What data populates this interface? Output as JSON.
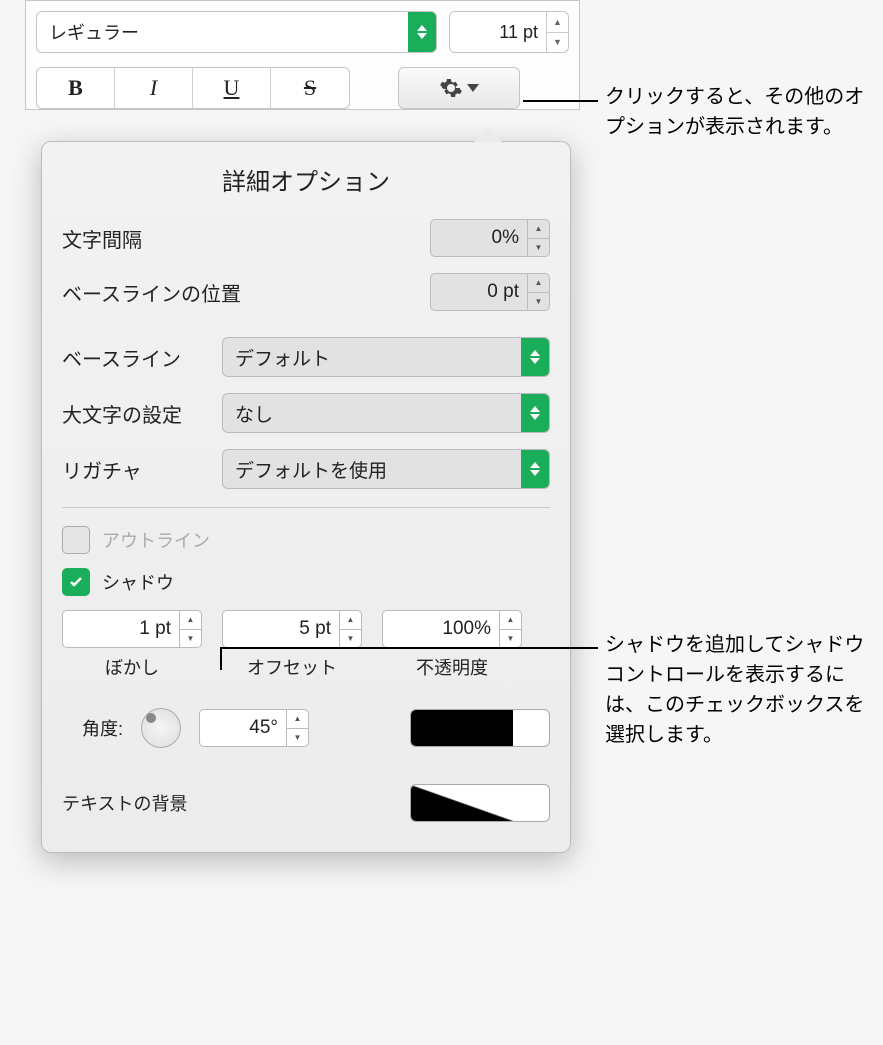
{
  "font": {
    "style": "レギュラー",
    "size": "11 pt",
    "bold": "B",
    "italic": "I",
    "underline": "U",
    "strike": "S"
  },
  "popover": {
    "title": "詳細オプション",
    "char_spacing_label": "文字間隔",
    "char_spacing_value": "0%",
    "baseline_shift_label": "ベースラインの位置",
    "baseline_shift_value": "0 pt",
    "baseline_label": "ベースライン",
    "baseline_value": "デフォルト",
    "caps_label": "大文字の設定",
    "caps_value": "なし",
    "ligature_label": "リガチャ",
    "ligature_value": "デフォルトを使用",
    "outline_label": "アウトライン",
    "shadow_label": "シャドウ",
    "blur_label": "ぼかし",
    "blur_value": "1 pt",
    "offset_label": "オフセット",
    "offset_value": "5 pt",
    "opacity_label": "不透明度",
    "opacity_value": "100%",
    "angle_label": "角度:",
    "angle_value": "45°",
    "textbg_label": "テキストの背景"
  },
  "callouts": {
    "gear": "クリックすると、その他のオプションが表示されます。",
    "shadow": "シャドウを追加してシャドウコントロールを表示するには、このチェックボックスを選択します。"
  }
}
